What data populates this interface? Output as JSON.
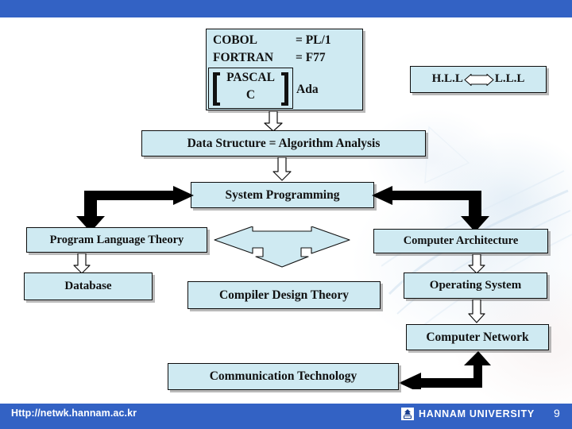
{
  "colors": {
    "chrome_bar": "#3362c4",
    "box_fill": "#cfeaf2",
    "box_border": "#0d0d0d",
    "arrow_solid": "#000000",
    "arrow_hollow_fill": "#ffffff",
    "arrow_blue_fill": "#cfeaf2",
    "footer_text": "#ffffff"
  },
  "diagram": {
    "languages_box": {
      "cobol": "COBOL",
      "cobol_eq": "= PL/1",
      "fortran": "FORTRAN",
      "fortran_eq": "= F77",
      "pascal": "PASCAL",
      "c": "C",
      "ada": "Ada"
    },
    "hll_box": {
      "left_label": "H.L.L",
      "right_label": "L.L.L"
    },
    "nodes": {
      "data_structure": "Data Structure = Algorithm Analysis",
      "system_programming": "System Programming",
      "program_language_theory": "Program Language Theory",
      "computer_architecture": "Computer Architecture",
      "database": "Database",
      "compiler_design_theory": "Compiler Design Theory",
      "operating_system": "Operating System",
      "computer_network": "Computer Network",
      "communication_technology": "Communication Technology"
    }
  },
  "footer": {
    "url": "Http://netwk.hannam.ac.kr",
    "university": "HANNAM UNIVERSITY",
    "page_number": "9",
    "logo_icon": "hannam-crest-icon"
  }
}
